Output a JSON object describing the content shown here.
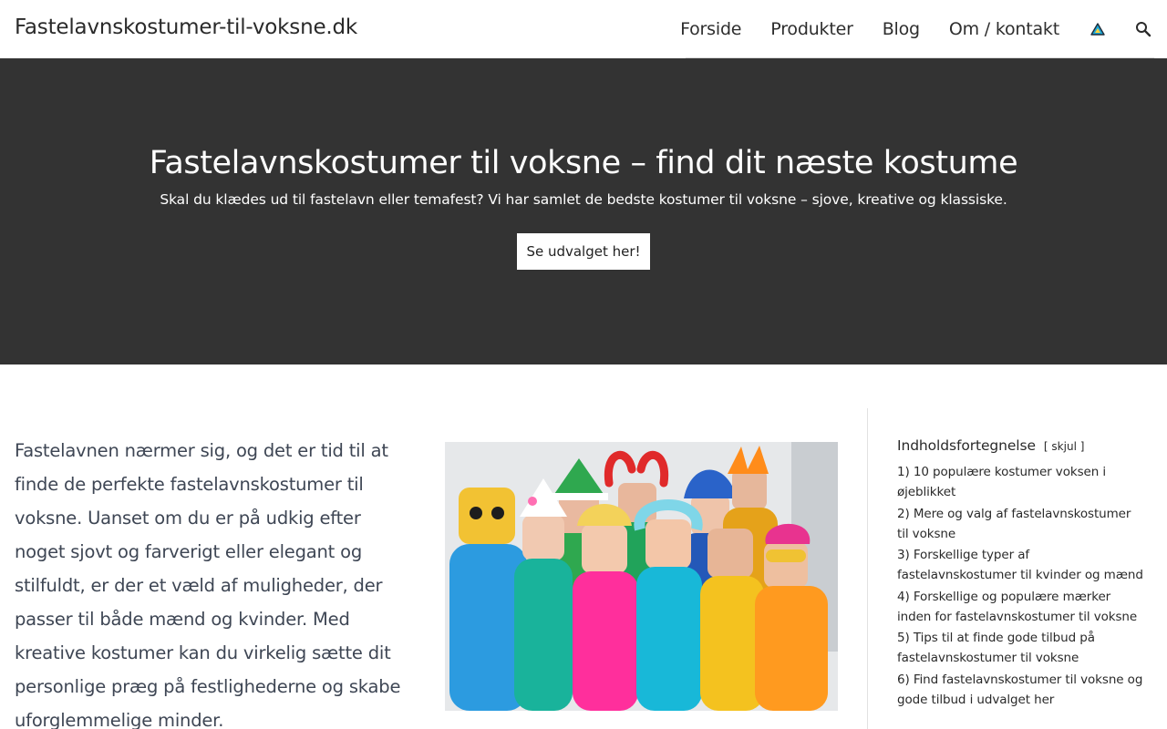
{
  "header": {
    "site_title": "Fastelavnskostumer-til-voksne.dk",
    "nav": [
      "Forside",
      "Produkter",
      "Blog",
      "Om / kontakt"
    ],
    "icons": {
      "flag": "warning-triangle-icon",
      "search": "search-icon"
    }
  },
  "hero": {
    "title": "Fastelavnskostumer til voksne – find dit næste kostume",
    "subtitle": "Skal du klædes ud til fastelavn eller temafest? Vi har samlet de bedste kostumer til voksne – sjove, kreative og klassiske.",
    "button_label": "Se udvalget her!"
  },
  "content": {
    "intro": "Fastelavnen nærmer sig, og det er tid til at finde de perfekte fastelavnskostumer til voksne. Uanset om du er på udkig efter noget sjovt og farverigt eller elegant og stilfuldt, er der et væld af muligheder, der passer til både mænd og kvinder. Med kreative kostumer kan du virkelig sætte dit personlige præg på festlighederne og skabe uforglemmelige minder."
  },
  "toc": {
    "title": "Indholdsfortegnelse",
    "toggle_open": "[",
    "toggle_label": "skjul",
    "toggle_close": "]",
    "items": [
      {
        "label": "1) 10 populære kostumer voksen i øjeblikket"
      },
      {
        "label": "2) Mere og valg af fastelavnskostumer til voksne"
      },
      {
        "label": "3) Forskellige typer af fastelavnskostumer til kvinder og mænd"
      },
      {
        "label": "4) Forskellige og populære mærker inden for fastelavnskostumer til voksne"
      },
      {
        "label": "5) Tips til at finde gode tilbud på fastelavnskostumer til voksne"
      },
      {
        "label": "6) Find fastelavnskostumer til voksne og gode tilbud i udvalget her"
      }
    ]
  },
  "colors": {
    "hero_bg": "#333333",
    "text": "#2b2b2b",
    "intro_text": "#3e4654"
  }
}
